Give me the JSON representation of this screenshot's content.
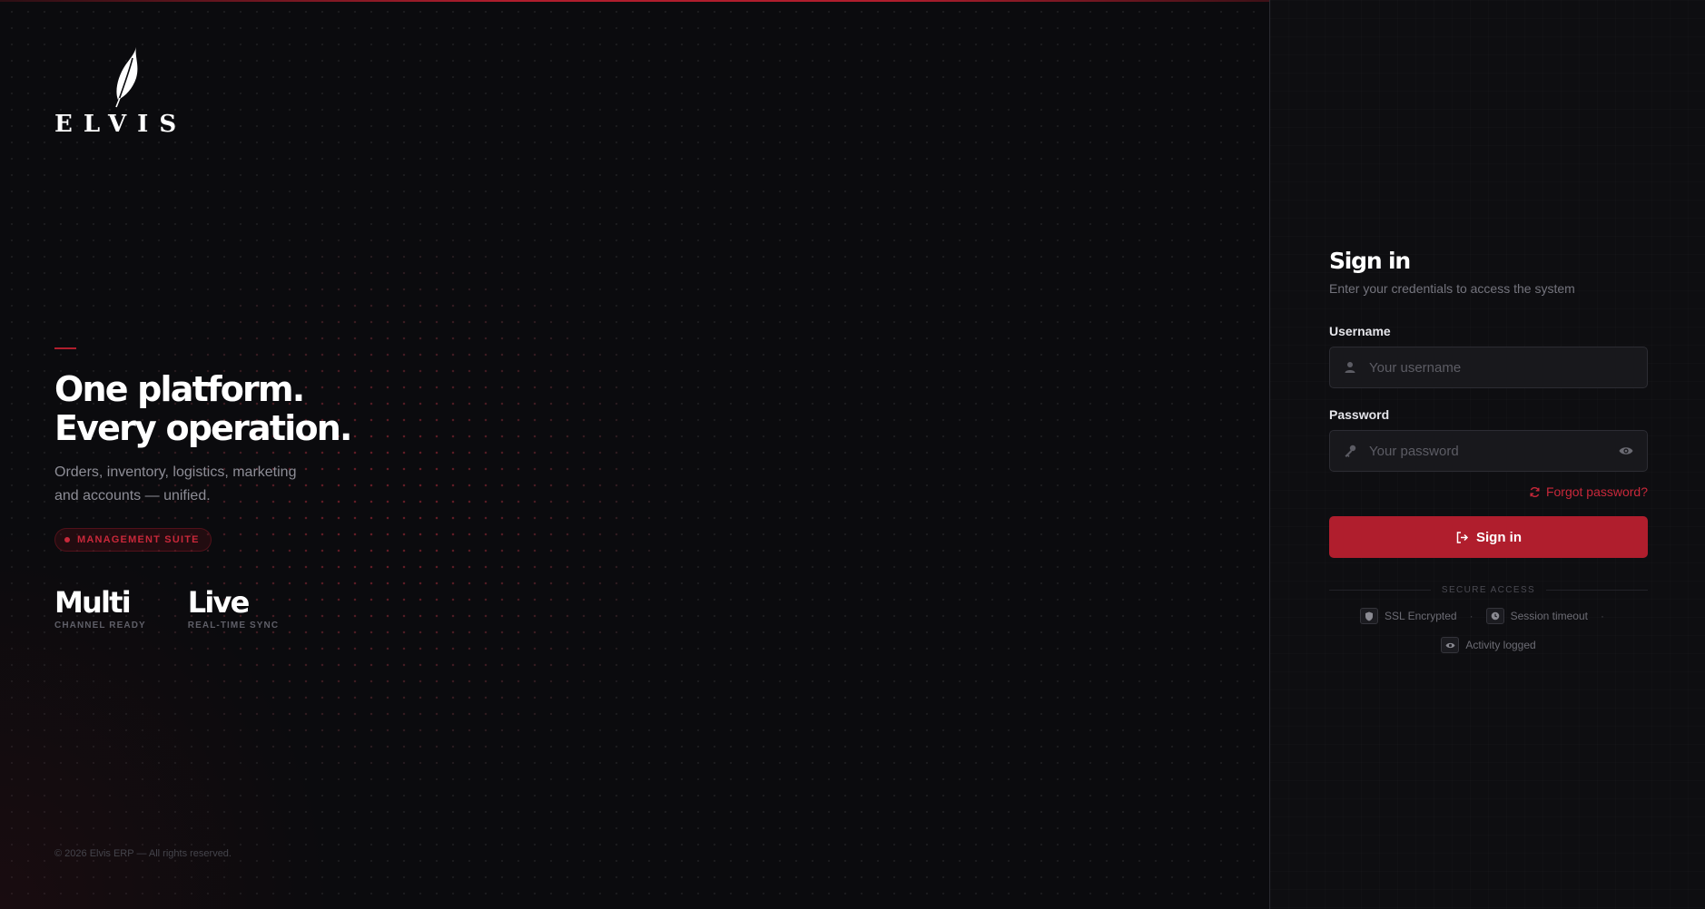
{
  "brand": {
    "name": "ELVIS"
  },
  "hero": {
    "headline_line1": "One platform.",
    "headline_line2": "Every operation.",
    "subtext": "Orders, inventory, logistics, marketing and accounts — unified.",
    "badge": "MANAGEMENT SUITE",
    "stats": [
      {
        "value": "Multi",
        "label": "CHANNEL READY"
      },
      {
        "value": "Live",
        "label": "REAL-TIME SYNC"
      }
    ],
    "copyright": "© 2026 Elvis ERP — All rights reserved."
  },
  "signin": {
    "title": "Sign in",
    "subtitle": "Enter your credentials to access the system",
    "username_label": "Username",
    "username_placeholder": "Your username",
    "password_label": "Password",
    "password_placeholder": "Your password",
    "forgot": "Forgot password?",
    "button": "Sign in",
    "secure_heading": "SECURE ACCESS",
    "security_items": [
      "SSL Encrypted",
      "Session timeout",
      "Activity logged"
    ]
  },
  "colors": {
    "accent": "#b01e2d",
    "background": "#0b0b0e",
    "panel": "#0e0e11"
  }
}
